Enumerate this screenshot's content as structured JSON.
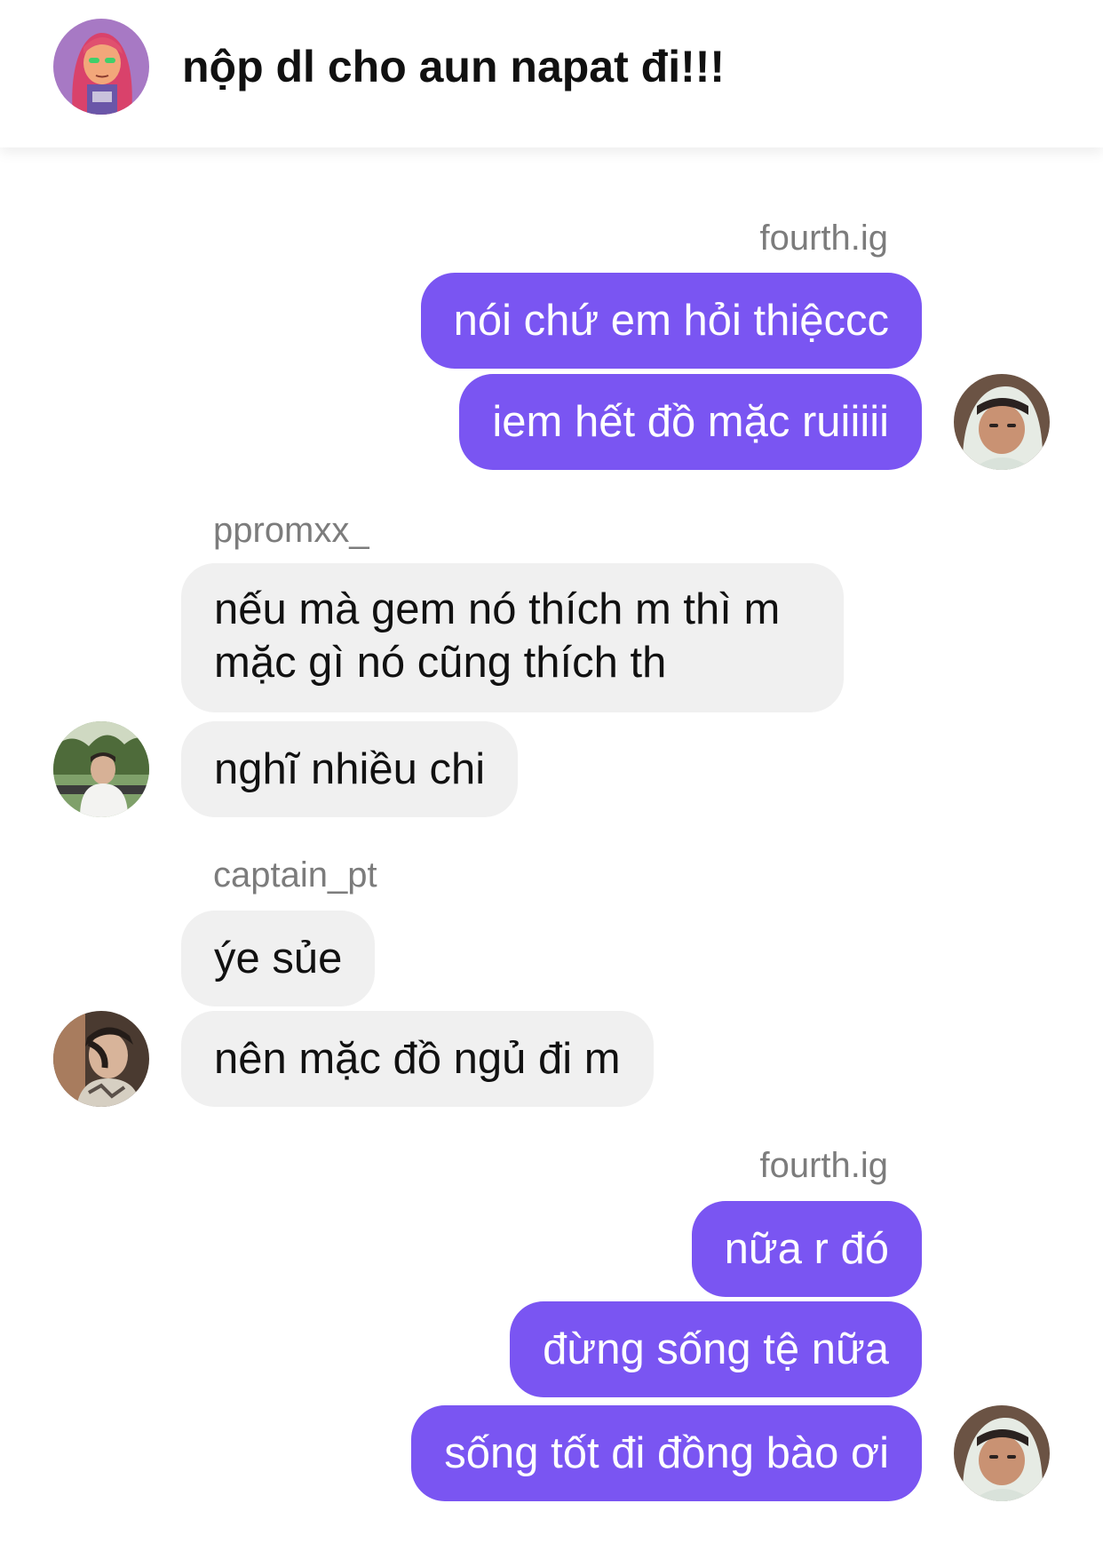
{
  "header": {
    "title": "nộp dl cho aun napat đi!!!"
  },
  "messages": {
    "g1": {
      "sender": "fourth.ig",
      "bubbles": [
        "nói chứ em hỏi thiệccc",
        "iem hết đồ mặc ruiiiii"
      ]
    },
    "g2": {
      "sender": "ppromxx_",
      "bubbles": [
        "nếu mà gem nó thích m thì m mặc gì nó cũng thích th",
        "nghĩ nhiều chi"
      ]
    },
    "g3": {
      "sender": "captain_pt",
      "bubbles": [
        "ýe sủe",
        "nên mặc đồ ngủ đi m"
      ]
    },
    "g4": {
      "sender": "fourth.ig",
      "bubbles": [
        "nữa r đó",
        "đừng sống tệ nữa",
        "sống tốt đi đồng bào ơi"
      ]
    }
  },
  "colors": {
    "outgoing_bubble": "#7a55f2",
    "incoming_bubble": "#f0f0f0",
    "sender_name": "#7c7c7c"
  },
  "icons": {
    "group_avatar": "cartoon-girl-avatar",
    "fourth_avatar": "hooded-person-avatar",
    "ppromxx_avatar": "outdoor-person-avatar",
    "captain_avatar": "person-portrait-avatar"
  }
}
